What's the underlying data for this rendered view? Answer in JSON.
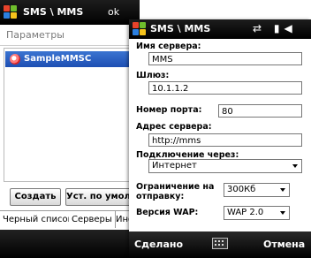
{
  "back_window": {
    "title": "SMS \\ MMS",
    "status_icons": "⇄ ↑▮ ◀",
    "ok_label": "ok",
    "header": "Параметры",
    "servers": [
      {
        "name": "SampleMMSC"
      }
    ],
    "buttons": {
      "create": "Создать",
      "set_default": "Уст. по умолчанию"
    },
    "tabs": [
      "Черный список",
      "Серверы",
      "Информация"
    ]
  },
  "front_window": {
    "title": "SMS \\ MMS",
    "fields": {
      "server_name": {
        "label": "Имя сервера:",
        "value": "MMS"
      },
      "gateway": {
        "label": "Шлюз:",
        "value": "10.1.1.2"
      },
      "port": {
        "label": "Номер порта:",
        "value": "80"
      },
      "server_address": {
        "label": "Адрес сервера:",
        "value": "http://mms"
      },
      "connect_via": {
        "label": "Подключение через:",
        "value": "Интернет"
      },
      "send_limit": {
        "label_line1": "Ограничение на",
        "label_line2": "отправку:",
        "value": "300Кб"
      },
      "wap_version": {
        "label": "Версия WAP:",
        "value": "WAP 2.0"
      }
    },
    "command_bar": {
      "left": "Сделано",
      "right": "Отмена"
    }
  }
}
